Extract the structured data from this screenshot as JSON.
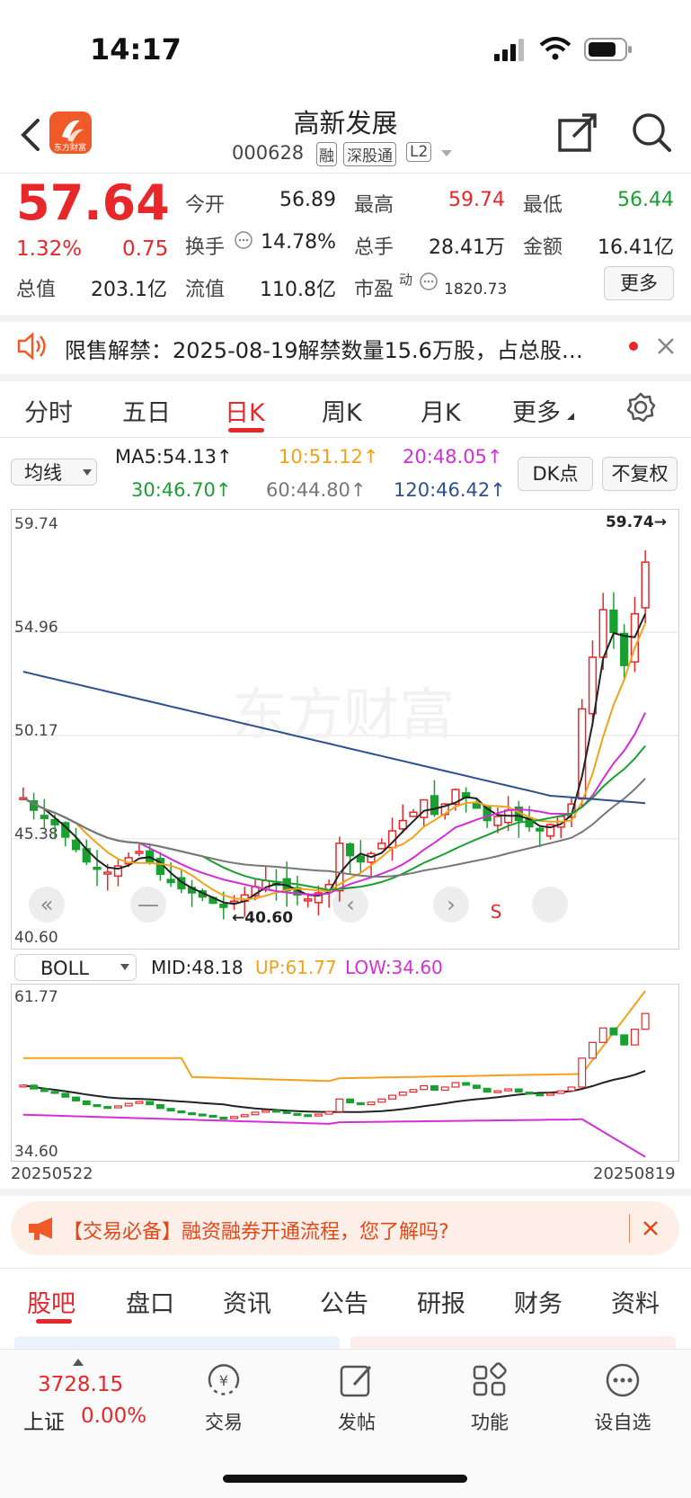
{
  "status_bar": {
    "time": "14:17"
  },
  "header": {
    "title": "高新发展",
    "code": "000628",
    "tag_rong": "融",
    "tag_sgt": "深股通",
    "tag_level": "L2"
  },
  "quote": {
    "price": "57.64",
    "change_pct": "1.32%",
    "change_amt": "0.75",
    "open_label": "今开",
    "open_value": "56.89",
    "high_label": "最高",
    "high_value": "59.74",
    "low_label": "最低",
    "low_value": "56.44",
    "turnover_label": "换手",
    "turnover_value": "14.78%",
    "volume_label": "总手",
    "volume_value": "28.41万",
    "amount_label": "金额",
    "amount_value": "16.41亿",
    "mcap_label": "总值",
    "mcap_value": "203.1亿",
    "float_label": "流值",
    "float_value": "110.8亿",
    "pe_label": "市盈",
    "pe_sup": "动",
    "pe_value": "1820.73",
    "more_button": "更多"
  },
  "notice": {
    "text": "限售解禁：2025-08-19解禁数量15.6万股，占总股…"
  },
  "period_tabs": [
    "分时",
    "五日",
    "日K",
    "周K",
    "月K",
    "更多"
  ],
  "active_tab": "日K",
  "ma_panel": {
    "selector": "均线",
    "ma5": "MA5:54.13↑",
    "ma10": "10:51.12↑",
    "ma20": "20:48.05↑",
    "ma30": "30:46.70↑",
    "ma60": "60:44.80↑",
    "ma120": "120:46.42↑",
    "dk_button": "DK点",
    "adjust_button": "不复权"
  },
  "chart_data": [
    {
      "type": "candlestick",
      "y_ticks": [
        "59.74",
        "54.96",
        "50.17",
        "45.38",
        "40.60"
      ],
      "ylim": [
        40.6,
        59.74
      ],
      "high_annotation": "59.74→",
      "low_annotation": "←40.60",
      "watermark": "东方财富",
      "signal_s": "S",
      "series_colors": {
        "ma5": "#222222",
        "ma10": "#f2a21a",
        "ma20": "#d22fd4",
        "ma30": "#1aa032",
        "ma60": "#777777",
        "ma120": "#2f4f8f"
      }
    },
    {
      "type": "line",
      "indicator": "BOLL",
      "mid_label": "MID:48.18",
      "up_label": "UP:61.77",
      "low_label": "LOW:34.60",
      "y_ticks": [
        "61.77",
        "34.60"
      ],
      "x_start": "20250522",
      "x_end": "20250819"
    }
  ],
  "ad_banner": {
    "text": "【交易必备】融资融券开通流程，您了解吗?"
  },
  "bottom_tabs": [
    "股吧",
    "盘口",
    "资讯",
    "公告",
    "研报",
    "财务",
    "资料"
  ],
  "active_bottom_tab": "股吧",
  "dock": {
    "index_value": "3728.15",
    "index_name": "上证",
    "index_change": "0.00%",
    "items": [
      "交易",
      "发帖",
      "功能",
      "设自选"
    ]
  }
}
